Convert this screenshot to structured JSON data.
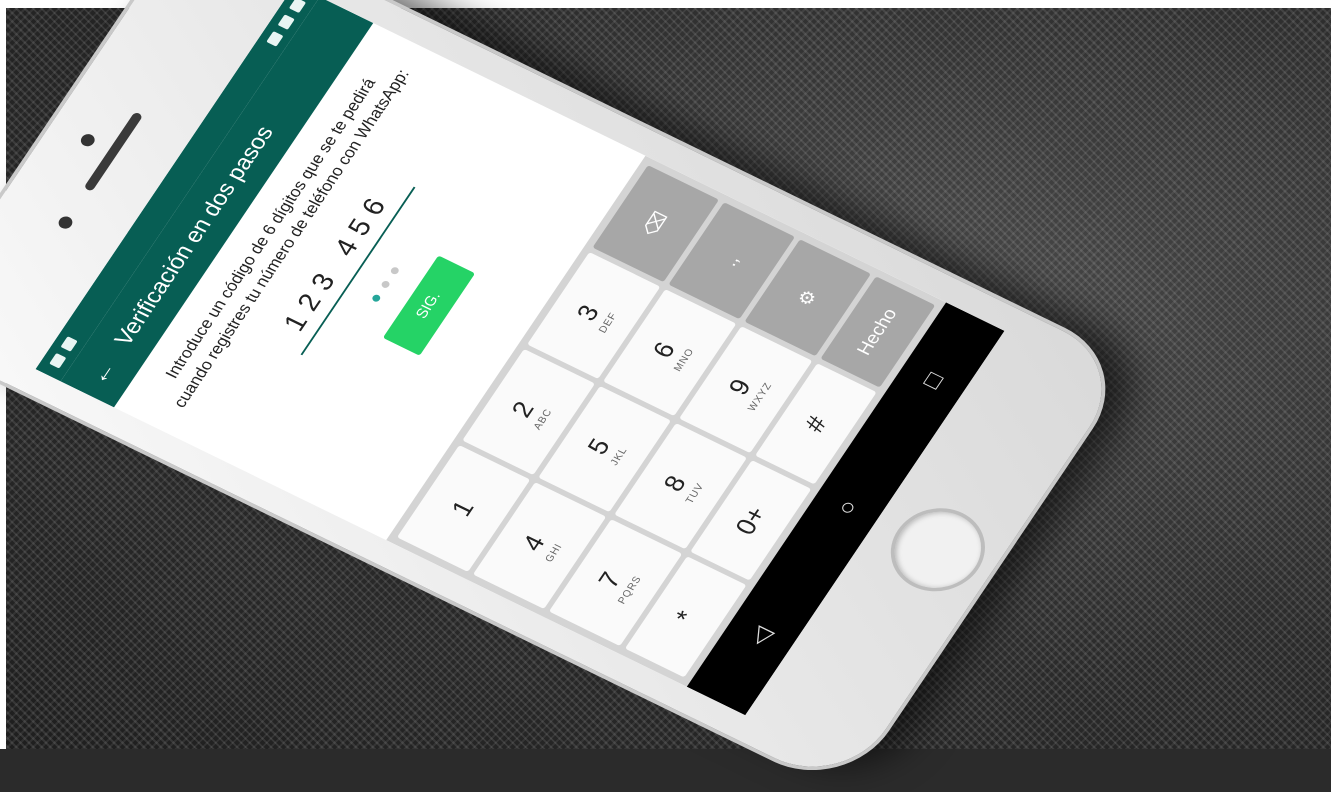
{
  "app": {
    "title": "Verificación en dos pasos",
    "description": "Introduce un código de 6 dígitos que se te pedirá cuando registres tu número de teléfono con WhatsApp:",
    "code_value": "123 456",
    "next_label": "SIG.",
    "progress_dots": [
      true,
      false,
      false
    ]
  },
  "keypad": {
    "keys": [
      {
        "num": "1",
        "sub": ""
      },
      {
        "num": "2",
        "sub": "ABC"
      },
      {
        "num": "3",
        "sub": "DEF"
      },
      {
        "num": "⌫",
        "sub": ""
      },
      {
        "num": "4",
        "sub": "GHI"
      },
      {
        "num": "5",
        "sub": "JKL"
      },
      {
        "num": "6",
        "sub": "MNO"
      },
      {
        "num": ".,",
        "sub": ""
      },
      {
        "num": "7",
        "sub": "PQRS"
      },
      {
        "num": "8",
        "sub": "TUV"
      },
      {
        "num": "9",
        "sub": "WXYZ"
      },
      {
        "num": "⚙",
        "sub": ""
      },
      {
        "num": "*",
        "sub": ""
      },
      {
        "num": "0+",
        "sub": ""
      },
      {
        "num": "#",
        "sub": ""
      },
      {
        "num": "Hecho",
        "sub": ""
      }
    ]
  },
  "navbar": {
    "back": "◁",
    "home": "○",
    "recent": "□"
  },
  "colors": {
    "whatsapp_teal": "#075e54",
    "next_green": "#25d366"
  }
}
